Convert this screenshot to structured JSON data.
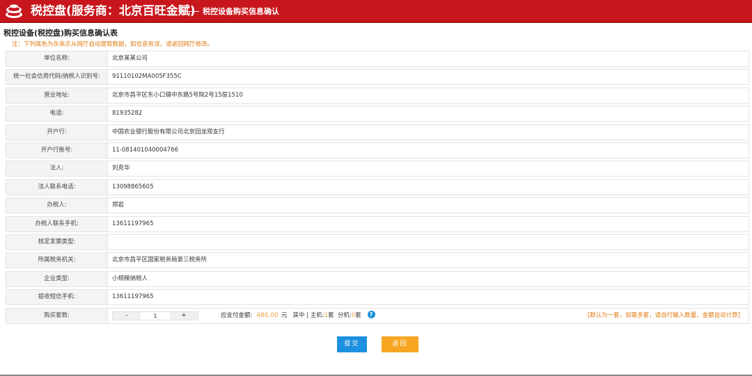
{
  "header": {
    "title": "税控盘(服务商：北京百旺金赋)",
    "subtitle": "税控设备购买信息确认",
    "logo_icon": "stacked-coins-logo",
    "brand_color": "#c8161d"
  },
  "page": {
    "title": "税控设备(税控盘)购买信息确认表",
    "note": "注：下列底色为灰表示从网厅自动提取数据，如信息有误，请返回网厅修改。"
  },
  "fields": [
    {
      "label": "单位名称:",
      "value": "北京某某公司"
    },
    {
      "label": "统一社会信用代码/纳税人识别号:",
      "value": "91110102MA005F355C"
    },
    {
      "label": "营业地址:",
      "value": "北京市昌平区东小口镇中东路5号院2号15层1510"
    },
    {
      "label": "电话:",
      "value": "81935282"
    },
    {
      "label": "开户行:",
      "value": "中国农业银行股份有限公司北京回龙观支行"
    },
    {
      "label": "开户行账号:",
      "value": "11-081401040004766"
    },
    {
      "label": "法人:",
      "value": "刘克华"
    },
    {
      "label": "法人联系电话:",
      "value": "13098865605"
    },
    {
      "label": "办税人:",
      "value": "郑岩"
    },
    {
      "label": "办税人联系手机:",
      "value": "13611197965"
    },
    {
      "label": "核定发票类型:",
      "value": ""
    },
    {
      "label": "所属税务机关:",
      "value": "北京市昌平区国家税务局第三税务所"
    },
    {
      "label": "企业类型:",
      "value": "小规模纳税人"
    },
    {
      "label": "接收短信手机:",
      "value": "13611197965"
    }
  ],
  "purchase": {
    "label": "购买套数:",
    "minus": "-",
    "plus": "+",
    "quantity": "1",
    "amount_label": "应支付金额:",
    "amount": "480.00",
    "unit": "元",
    "breakdown_prefix": "其中 | 主机:",
    "host_count": "1",
    "set_unit_1": "套",
    "ext_label": "分机:",
    "ext_count": "0",
    "set_unit_2": "套",
    "help_icon": "?",
    "hint": "[默认为一套，如需多套，请自行输入数量，金额自动计算]"
  },
  "buttons": {
    "submit": "提交",
    "back": "返回"
  },
  "colors": {
    "note": "#e07a12",
    "amount": "#e8a33a",
    "submit": "#1e90e0",
    "back": "#f6a623"
  }
}
